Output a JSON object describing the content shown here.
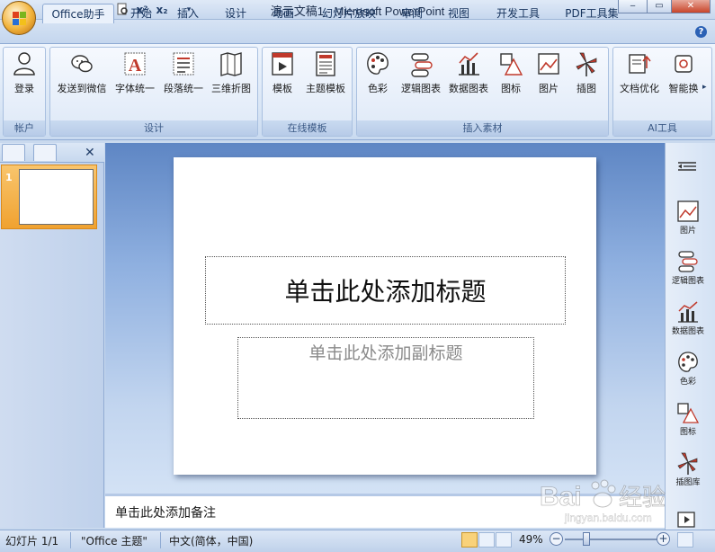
{
  "window": {
    "title": "演示文稿1 - Microsoft PowerPoint"
  },
  "quick_access": [
    "save-icon",
    "undo-icon",
    "redo-icon",
    "print-preview-icon",
    "superscript-icon",
    "subscript-icon",
    "customize-icon"
  ],
  "tabs": [
    {
      "label": "Office助手",
      "active": true
    },
    {
      "label": "开始"
    },
    {
      "label": "插入"
    },
    {
      "label": "设计"
    },
    {
      "label": "动画"
    },
    {
      "label": "幻灯片放映"
    },
    {
      "label": "审阅"
    },
    {
      "label": "视图"
    },
    {
      "label": "开发工具"
    },
    {
      "label": "PDF工具集"
    }
  ],
  "ribbon": {
    "groups": [
      {
        "label": "帐户",
        "buttons": [
          {
            "label": "登录",
            "icon": "user-icon"
          }
        ]
      },
      {
        "label": "设计",
        "buttons": [
          {
            "label": "发送到微信",
            "icon": "wechat-icon"
          },
          {
            "label": "字体统一",
            "icon": "font-icon"
          },
          {
            "label": "段落统一",
            "icon": "paragraph-icon"
          },
          {
            "label": "三维折图",
            "icon": "fold-map-icon"
          }
        ]
      },
      {
        "label": "在线模板",
        "buttons": [
          {
            "label": "模板",
            "icon": "template-icon"
          },
          {
            "label": "主题模板",
            "icon": "theme-template-icon"
          }
        ]
      },
      {
        "label": "插入素材",
        "buttons": [
          {
            "label": "色彩",
            "icon": "palette-icon"
          },
          {
            "label": "逻辑图表",
            "icon": "logic-chart-icon"
          },
          {
            "label": "数据图表",
            "icon": "data-chart-icon"
          },
          {
            "label": "图标",
            "icon": "shapes-icon"
          },
          {
            "label": "图片",
            "icon": "picture-icon"
          },
          {
            "label": "插图",
            "icon": "illustration-icon"
          }
        ]
      },
      {
        "label": "AI工具",
        "buttons": [
          {
            "label": "文档优化",
            "icon": "doc-optimize-icon"
          },
          {
            "label": "智能换",
            "icon": "smart-replace-icon"
          }
        ]
      }
    ]
  },
  "slide_panel": {
    "slide_number": "1"
  },
  "slide": {
    "title_placeholder": "单击此处添加标题",
    "subtitle_placeholder": "单击此处添加副标题"
  },
  "notes_placeholder": "单击此处添加备注",
  "sidebar": [
    {
      "label": "图片",
      "icon": "picture-icon"
    },
    {
      "label": "逻辑图表",
      "icon": "logic-chart-icon"
    },
    {
      "label": "数据图表",
      "icon": "data-chart-icon"
    },
    {
      "label": "色彩",
      "icon": "palette-icon"
    },
    {
      "label": "图标",
      "icon": "shapes-icon"
    },
    {
      "label": "插图库",
      "icon": "illustration-icon"
    }
  ],
  "statusbar": {
    "slide_info": "幻灯片 1/1",
    "theme": "\"Office 主题\"",
    "language": "中文(简体，中国)",
    "zoom": "49%"
  },
  "watermark": {
    "text": "Baidu经验",
    "sub": "jingyan.baidu.com"
  },
  "colors": {
    "ribbon_accent": "#8eaad3",
    "thumb_selected": "#f0a230",
    "editor_bg": "#8fb0e0"
  }
}
